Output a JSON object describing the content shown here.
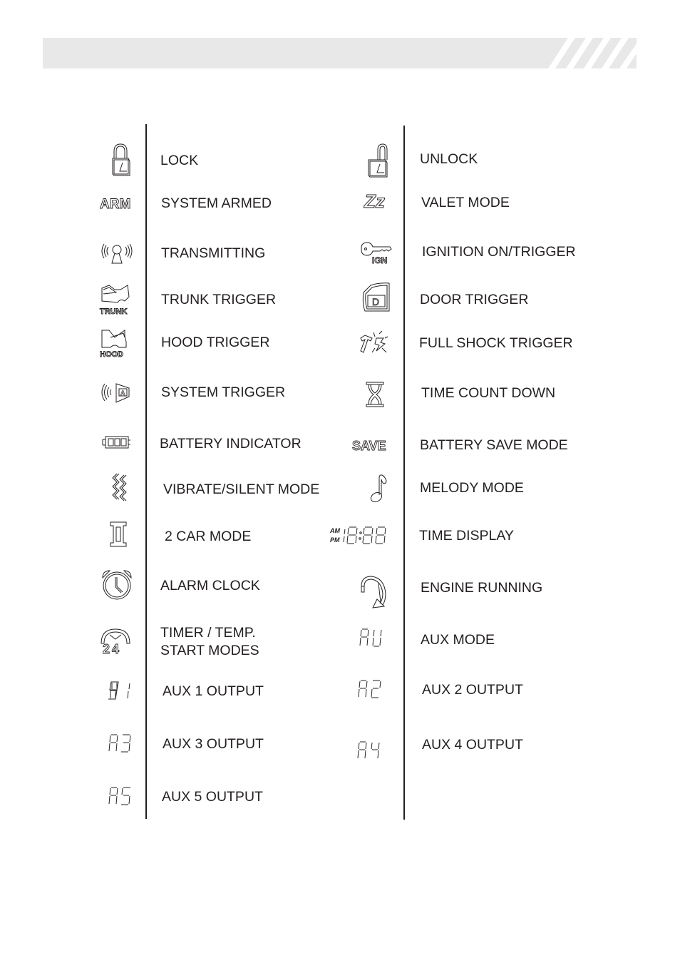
{
  "header": {
    "banner": "gray header band with diagonal stripes"
  },
  "left_column": [
    {
      "icon": "lock-icon",
      "label": "LOCK"
    },
    {
      "icon": "arm-icon",
      "icon_text": "ARM",
      "label": "SYSTEM ARMED"
    },
    {
      "icon": "transmitting-icon",
      "label": "TRANSMITTING"
    },
    {
      "icon": "trunk-icon",
      "icon_text": "TRUNK",
      "label": "TRUNK TRIGGER"
    },
    {
      "icon": "hood-icon",
      "icon_text": "HOOD",
      "label": "HOOD TRIGGER"
    },
    {
      "icon": "system-trigger-icon",
      "label": "SYSTEM TRIGGER"
    },
    {
      "icon": "battery-icon",
      "label": "BATTERY INDICATOR"
    },
    {
      "icon": "vibrate-icon",
      "label": "VIBRATE/SILENT MODE"
    },
    {
      "icon": "two-car-icon",
      "label": "2 CAR MODE"
    },
    {
      "icon": "alarm-clock-icon",
      "label": "ALARM CLOCK"
    },
    {
      "icon": "timer-24-icon",
      "icon_text": "24",
      "label_line1": "TIMER / TEMP.",
      "label_line2": "START MODES"
    },
    {
      "icon": "aux1-icon",
      "icon_text": "A 1",
      "label": "AUX 1 OUTPUT"
    },
    {
      "icon": "aux3-icon",
      "icon_text": "A3",
      "label": "AUX 3 OUTPUT"
    },
    {
      "icon": "aux5-icon",
      "icon_text": "A5",
      "label": "AUX 5 OUTPUT"
    }
  ],
  "right_column": [
    {
      "icon": "unlock-icon",
      "label": "UNLOCK"
    },
    {
      "icon": "valet-zz-icon",
      "icon_text": "Zz",
      "label": "VALET MODE"
    },
    {
      "icon": "ignition-key-icon",
      "icon_text": "IGN",
      "label": "IGNITION ON/TRIGGER"
    },
    {
      "icon": "door-icon",
      "icon_text": "D",
      "label": "DOOR TRIGGER"
    },
    {
      "icon": "shock-icon",
      "label": "FULL SHOCK TRIGGER"
    },
    {
      "icon": "hourglass-icon",
      "label": "TIME COUNT DOWN"
    },
    {
      "icon": "save-icon",
      "icon_text": "SAVE",
      "label": "BATTERY SAVE MODE"
    },
    {
      "icon": "music-note-icon",
      "label": "MELODY MODE"
    },
    {
      "icon": "time-display-icon",
      "icon_text_am": "AM",
      "icon_text_pm": "PM",
      "icon_text": "18:88",
      "label": "TIME DISPLAY"
    },
    {
      "icon": "engine-running-icon",
      "label": "ENGINE RUNNING"
    },
    {
      "icon": "aux-mode-icon",
      "icon_text": "AU",
      "label": "AUX MODE"
    },
    {
      "icon": "aux2-icon",
      "icon_text": "A2",
      "label": "AUX 2 OUTPUT"
    },
    {
      "icon": "aux4-icon",
      "icon_text": "A4",
      "label": "AUX 4 OUTPUT"
    }
  ]
}
